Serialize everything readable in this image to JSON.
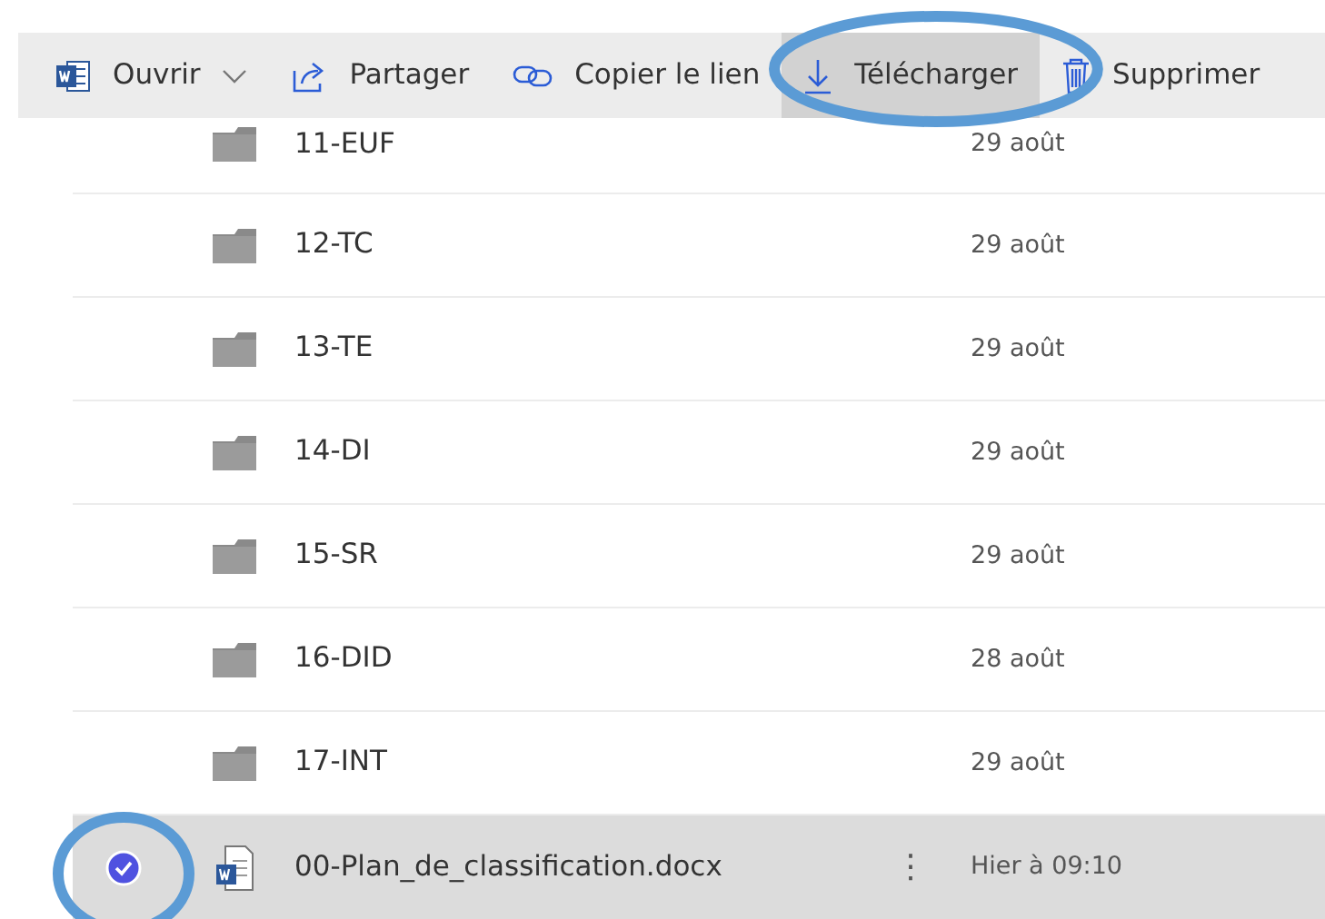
{
  "toolbar": [
    {
      "label": "Ouvrir",
      "kind": "word",
      "dropdown": true,
      "highlighted": false
    },
    {
      "label": "Partager",
      "kind": "share",
      "dropdown": false,
      "highlighted": false
    },
    {
      "label": "Copier le lien",
      "kind": "link",
      "dropdown": false,
      "highlighted": false
    },
    {
      "label": "Télécharger",
      "kind": "download",
      "dropdown": false,
      "highlighted": true
    },
    {
      "label": "Supprimer",
      "kind": "trash",
      "dropdown": false,
      "highlighted": false
    }
  ],
  "files": [
    {
      "kind": "folder",
      "name": "11-EUF",
      "modified": "29 août",
      "selected": false
    },
    {
      "kind": "folder",
      "name": "12-TC",
      "modified": "29 août",
      "selected": false
    },
    {
      "kind": "folder",
      "name": "13-TE",
      "modified": "29 août",
      "selected": false
    },
    {
      "kind": "folder",
      "name": "14-DI",
      "modified": "29 août",
      "selected": false
    },
    {
      "kind": "folder",
      "name": "15-SR",
      "modified": "29 août",
      "selected": false
    },
    {
      "kind": "folder",
      "name": "16-DID",
      "modified": "28 août",
      "selected": false
    },
    {
      "kind": "folder",
      "name": "17-INT",
      "modified": "29 août",
      "selected": false
    },
    {
      "kind": "word",
      "name": "00-Plan_de_classification.docx",
      "modified": "Hier à 09:10",
      "selected": true,
      "more": "⋮"
    }
  ]
}
